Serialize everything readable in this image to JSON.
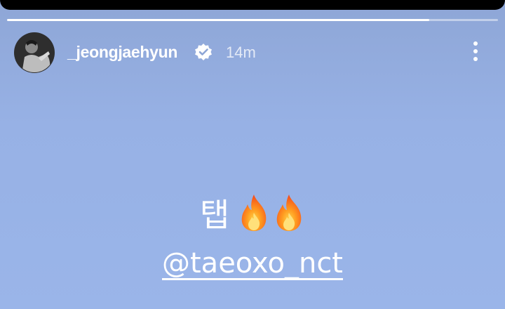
{
  "story": {
    "progress": 0.86,
    "username": "_jeongjaehyun",
    "verified": true,
    "time": "14m",
    "more_icon": "more-vertical-icon",
    "caption_text": "탭",
    "caption_emoji": [
      "fire-icon",
      "fire-icon"
    ],
    "mention": "@taeoxo_nct"
  },
  "colors": {
    "background": "#97b1e5",
    "text": "#ffffff"
  }
}
